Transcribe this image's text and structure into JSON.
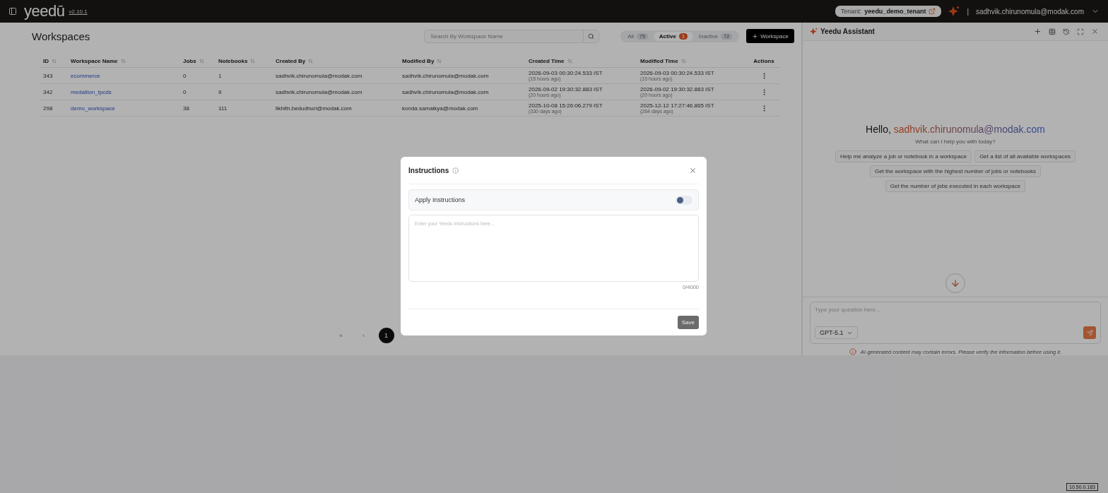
{
  "header": {
    "logo": "yeedū",
    "version": "v2.10.1",
    "tenant_label": "Tenant:",
    "tenant": "yeedu_demo_tenant",
    "divider": "|",
    "user": "sadhvik.chirunomula@modak.com"
  },
  "page": {
    "title": "Workspaces",
    "search": {
      "placeholder": "Search By Workspace Name"
    },
    "filters": [
      {
        "label": "All",
        "count": "75",
        "selected": false
      },
      {
        "label": "Active",
        "count": "3",
        "selected": true
      },
      {
        "label": "Inactive",
        "count": "72",
        "selected": false
      }
    ],
    "add_button": "Workspace"
  },
  "table": {
    "columns": [
      "ID",
      "Workspace Name",
      "Jobs",
      "Notebooks",
      "Created By",
      "Modified By",
      "Created Time",
      "Modified Time",
      "Actions"
    ],
    "rows": [
      {
        "id": "343",
        "name": "ecommerce",
        "jobs": "0",
        "notebooks": "1",
        "created_by": "sadhvik.chirunomula@modak.com",
        "modified_by": "sadhvik.chirunomula@modak.com",
        "created_time": "2026-09-03 00:30:24.533 IST",
        "created_ago": "(15 hours ago)",
        "modified_time": "2026-09-03 00:30:24.533 IST",
        "modified_ago": "(15 hours ago)"
      },
      {
        "id": "342",
        "name": "medallion_tpcds",
        "jobs": "0",
        "notebooks": "9",
        "created_by": "sadhvik.chirunomula@modak.com",
        "modified_by": "sadhvik.chirunomula@modak.com",
        "created_time": "2026-09-02 19:30:32.883 IST",
        "created_ago": "(20 hours ago)",
        "modified_time": "2026-09-02 19:30:32.883 IST",
        "modified_ago": "(20 hours ago)"
      },
      {
        "id": "298",
        "name": "demo_workspace",
        "jobs": "38",
        "notebooks": "111",
        "created_by": "likhith.bedudhuri@modak.com",
        "modified_by": "konda.samaikya@modak.com",
        "created_time": "2025-10-08 15:26:06.279 IST",
        "created_ago": "(330 days ago)",
        "modified_time": "2025-12-12 17:27:46.865 IST",
        "modified_ago": "(264 days ago)"
      }
    ]
  },
  "pagination": {
    "first": "«",
    "prev": "‹",
    "pages": [
      {
        "label": "1",
        "selected": true
      }
    ]
  },
  "assistant": {
    "title": "Yeedu Assistant",
    "greeting_prefix": "Hello,",
    "greeting_name": "sadhvik.chirunomula@modak.com",
    "subtitle": "What can I help you with today?",
    "suggestions": [
      "Help me analyze a job or notebook in a workspace",
      "Get a list of all available workspaces",
      "Get the workspace with the highest number of jobs or notebooks",
      "Get the number of jobs executed in each workspace"
    ],
    "input": {
      "placeholder": "Type your question here..."
    },
    "model": "GPT-5.1",
    "disclaimer": "AI-generated content may contain errors. Please verify the information before using it."
  },
  "modal": {
    "title": "Instructions",
    "apply": {
      "label": "Apply Instructions",
      "on": false
    },
    "textarea": {
      "placeholder": "Enter your Yeedu instructions here..."
    },
    "counter": "0/4000",
    "save": "Save"
  },
  "ip": "10.50.0.183"
}
